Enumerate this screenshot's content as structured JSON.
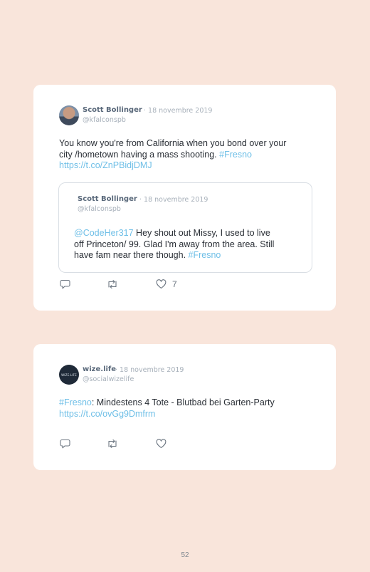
{
  "tweets": [
    {
      "author": "Scott Bollinger",
      "date": "· 18 novembre 2019",
      "handle": "@kfalconspb",
      "text_lines": [
        "You know you're from California when you bond over your",
        "city /hometown having a mass shooting. "
      ],
      "hashtag": "#Fresno",
      "url": "https://t.co/ZnPBidjDMJ",
      "quoted": {
        "author": "Scott Bollinger",
        "date": "· 18 novembre 2019",
        "handle": "@kfalconspb",
        "mention": "@CodeHer317",
        "text_line1": " Hey shout out Missy, I used to live",
        "text_line2": "off Princeton/ 99. Glad I'm away from the area. Still",
        "text_line3": "have fam near there though. ",
        "hashtag": "#Fresno"
      },
      "like_count": "7",
      "icons": [
        "reply-icon",
        "retweet-icon",
        "like-icon"
      ]
    },
    {
      "author": "wize.life",
      "date": "· 18 novembre 2019",
      "handle": "@socialwizelife",
      "avatar_text": "WIZE.LIFE",
      "hashtag": "#Fresno",
      "text_rest": ": Mindestens 4 Tote - Blutbad bei Garten-Party",
      "url": "https://t.co/ovGg9Dmfrm",
      "icons": [
        "reply-icon",
        "retweet-icon",
        "like-icon"
      ]
    }
  ],
  "page_number": "52",
  "colors": {
    "background": "#f9e5db",
    "card": "#ffffff",
    "link": "#6fbfe7",
    "name": "#59687a",
    "muted": "#a7b0ba"
  }
}
